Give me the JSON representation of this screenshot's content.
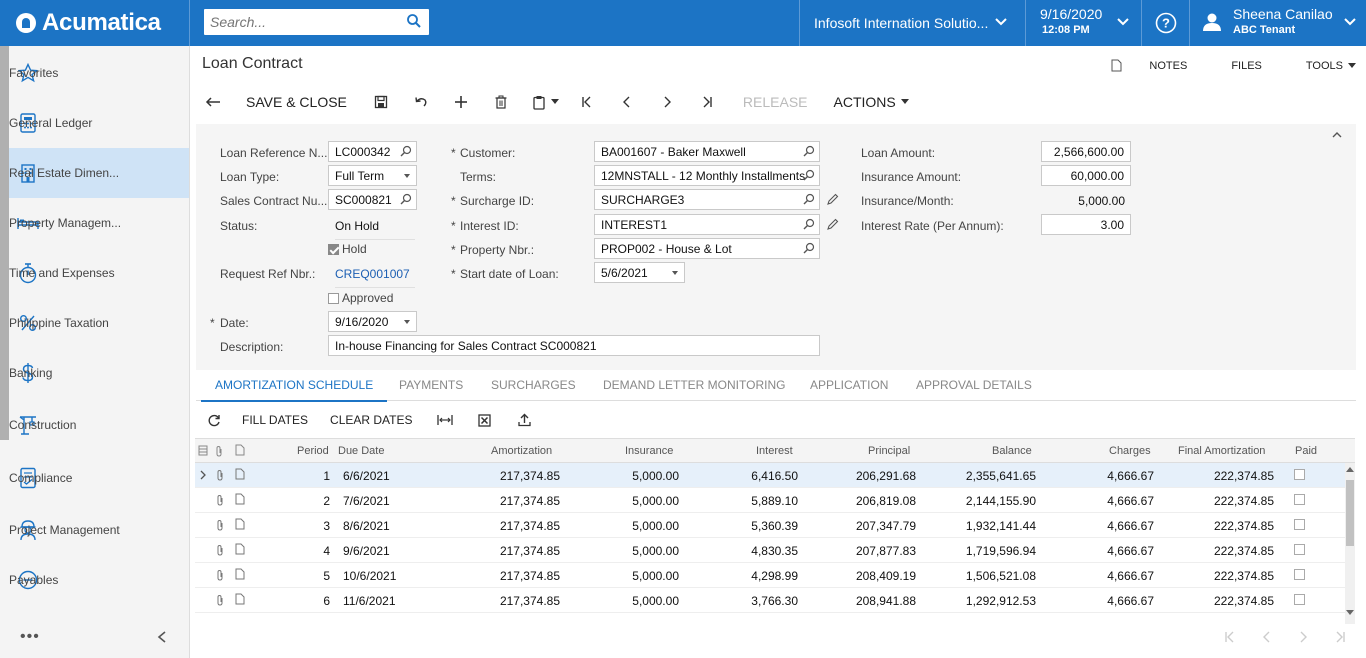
{
  "app": {
    "brand": "Acumatica",
    "search_placeholder": "Search...",
    "company": "Infosoft Internation Solutio...",
    "date": "9/16/2020",
    "time": "12:08 PM",
    "user_name": "Sheena Canilao",
    "user_tenant": "ABC Tenant",
    "accent": "#1c74c5"
  },
  "sidebar": {
    "items": [
      {
        "label": "Favorites",
        "icon": "star-icon"
      },
      {
        "label": "General Ledger",
        "icon": "calculator-icon"
      },
      {
        "label": "Real Estate Dimen...",
        "icon": "building-icon"
      },
      {
        "label": "Property Managem...",
        "icon": "bed-icon"
      },
      {
        "label": "Time and Expenses",
        "icon": "stopwatch-icon"
      },
      {
        "label": "Philippine Taxation",
        "icon": "percent-icon"
      },
      {
        "label": "Banking",
        "icon": "dollar-icon"
      },
      {
        "label": "Construction",
        "icon": "crane-icon"
      },
      {
        "label": "Compliance",
        "icon": "checklist-icon"
      },
      {
        "label": "Project Management",
        "icon": "worker-icon"
      },
      {
        "label": "Payables",
        "icon": "minus-circle-icon"
      }
    ],
    "more": "•••"
  },
  "page": {
    "title": "Loan Contract",
    "links": {
      "notes": "NOTES",
      "files": "FILES",
      "tools": "TOOLS"
    }
  },
  "toolbar": {
    "save_close": "SAVE & CLOSE",
    "release": "RELEASE",
    "actions": "ACTIONS"
  },
  "form": {
    "loan_ref_label": "Loan Reference N...",
    "loan_ref": "LC000342",
    "loan_type_label": "Loan Type:",
    "loan_type": "Full Term",
    "sales_contract_label": "Sales Contract Nu...",
    "sales_contract": "SC000821",
    "status_label": "Status:",
    "status": "On Hold",
    "hold_label": "Hold",
    "request_ref_label": "Request Ref Nbr.:",
    "request_ref": "CREQ001007",
    "approved_label": "Approved",
    "date_label": "Date:",
    "date": "9/16/2020",
    "description_label": "Description:",
    "description": "In-house Financing for Sales Contract SC000821",
    "customer_label": "Customer:",
    "customer": "BA001607 - Baker Maxwell",
    "terms_label": "Terms:",
    "terms": "12MNSTALL - 12 Monthly Installments",
    "surcharge_label": "Surcharge ID:",
    "surcharge": "SURCHARGE3",
    "interest_label": "Interest ID:",
    "interest": "INTEREST1",
    "property_label": "Property Nbr.:",
    "property": "PROP002 - House & Lot",
    "start_label": "Start date of Loan:",
    "start": "5/6/2021",
    "loan_amount_label": "Loan Amount:",
    "loan_amount": "2,566,600.00",
    "insurance_amount_label": "Insurance Amount:",
    "insurance_amount": "60,000.00",
    "insurance_month_label": "Insurance/Month:",
    "insurance_month": "5,000.00",
    "interest_rate_label": "Interest Rate (Per Annum):",
    "interest_rate": "3.00",
    "required_mark": "*"
  },
  "tabs": [
    "AMORTIZATION SCHEDULE",
    "PAYMENTS",
    "SURCHARGES",
    "DEMAND LETTER MONITORING",
    "APPLICATION",
    "APPROVAL DETAILS"
  ],
  "grid_toolbar": {
    "fill_dates": "FILL DATES",
    "clear_dates": "CLEAR DATES"
  },
  "grid": {
    "columns": [
      "Period",
      "Due Date",
      "Amortization",
      "Insurance",
      "Interest",
      "Principal",
      "Balance",
      "Charges",
      "Final Amortization",
      "Paid"
    ],
    "rows": [
      [
        "1",
        "6/6/2021",
        "217,374.85",
        "5,000.00",
        "6,416.50",
        "206,291.68",
        "2,355,641.65",
        "4,666.67",
        "222,374.85"
      ],
      [
        "2",
        "7/6/2021",
        "217,374.85",
        "5,000.00",
        "5,889.10",
        "206,819.08",
        "2,144,155.90",
        "4,666.67",
        "222,374.85"
      ],
      [
        "3",
        "8/6/2021",
        "217,374.85",
        "5,000.00",
        "5,360.39",
        "207,347.79",
        "1,932,141.44",
        "4,666.67",
        "222,374.85"
      ],
      [
        "4",
        "9/6/2021",
        "217,374.85",
        "5,000.00",
        "4,830.35",
        "207,877.83",
        "1,719,596.94",
        "4,666.67",
        "222,374.85"
      ],
      [
        "5",
        "10/6/2021",
        "217,374.85",
        "5,000.00",
        "4,298.99",
        "208,409.19",
        "1,506,521.08",
        "4,666.67",
        "222,374.85"
      ],
      [
        "6",
        "11/6/2021",
        "217,374.85",
        "5,000.00",
        "3,766.30",
        "208,941.88",
        "1,292,912.53",
        "4,666.67",
        "222,374.85"
      ]
    ]
  }
}
